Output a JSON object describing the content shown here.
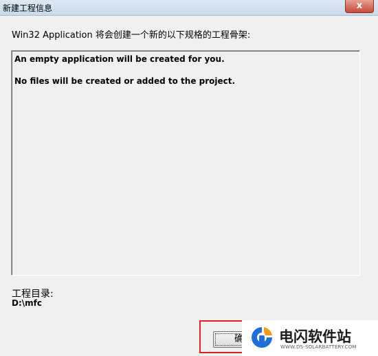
{
  "window": {
    "title": "新建工程信息",
    "close_label": "x"
  },
  "intro_text": "Win32 Application 将会创建一个新的以下规格的工程骨架:",
  "info_lines": [
    "An empty application will be created for you.",
    "No files will be created or added to the project."
  ],
  "project_dir": {
    "label": "工程目录:",
    "value": "D:\\mfc"
  },
  "ok_button": {
    "label": "确定"
  },
  "watermark": {
    "name": "电闪软件站",
    "url": "WWW.DS-SOLARBATTERY.COM"
  },
  "colors": {
    "highlight": "#e02020",
    "logo_blue": "#1e6fd9",
    "logo_orange": "#f59a1a"
  }
}
